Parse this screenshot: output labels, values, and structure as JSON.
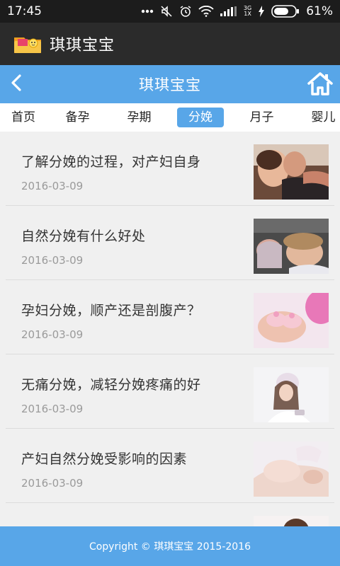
{
  "status_bar": {
    "time": "17:45",
    "network_top": "3G",
    "network_bottom": "1X",
    "battery": "61%"
  },
  "app": {
    "title": "琪琪宝宝"
  },
  "header": {
    "title": "琪琪宝宝"
  },
  "tabs": [
    {
      "label": "首页"
    },
    {
      "label": "备孕"
    },
    {
      "label": "孕期"
    },
    {
      "label": "分娩"
    },
    {
      "label": "月子"
    },
    {
      "label": "婴儿"
    }
  ],
  "articles": [
    {
      "title": "了解分娩的过程，对产妇自身",
      "date": "2016-03-09",
      "thumb": "couple-photo"
    },
    {
      "title": "自然分娩有什么好处",
      "date": "2016-03-09",
      "thumb": "newborn-photo"
    },
    {
      "title": "孕妇分娩，顺产还是剖腹产？",
      "date": "2016-03-09",
      "thumb": "baby-shoes-photo"
    },
    {
      "title": "无痛分娩，减轻分娩疼痛的好",
      "date": "2016-03-09",
      "thumb": "bride-photo"
    },
    {
      "title": "产妇自然分娩受影响的因素",
      "date": "2016-03-09",
      "thumb": "pregnant-belly-photo"
    },
    {
      "title": "",
      "date": "",
      "thumb": "partial-photo"
    }
  ],
  "footer": {
    "text": "Copyright © 琪琪宝宝 2015-2016"
  },
  "colors": {
    "accent": "#58a6e8",
    "app_bar": "#2b2b2b",
    "status_bar": "#1c1c1c"
  }
}
